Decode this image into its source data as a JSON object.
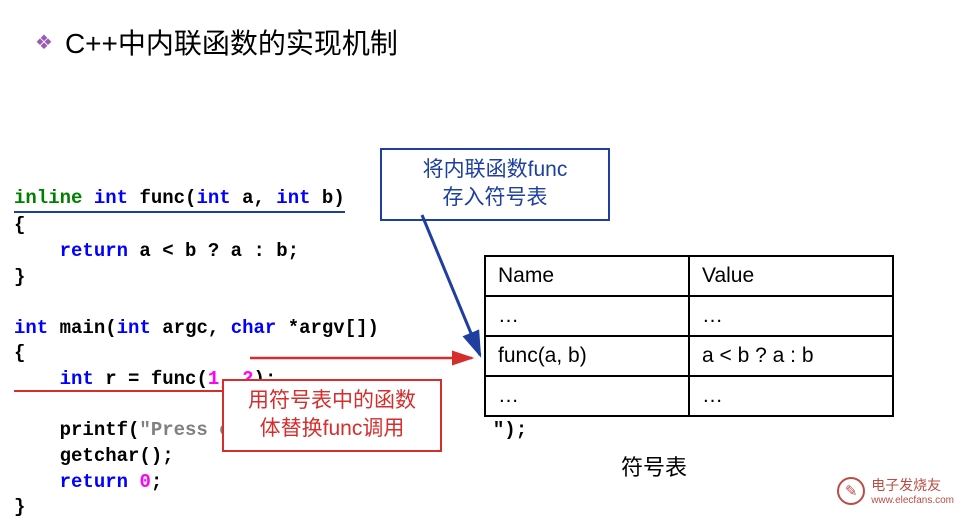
{
  "heading": {
    "bullet": "❖",
    "text": "C++中内联函数的实现机制"
  },
  "code": {
    "sig_inline": "inline",
    "sig_int1": "int",
    "sig_fname": " func(",
    "sig_int2": "int",
    "sig_a": " a, ",
    "sig_int3": "int",
    "sig_b": " b)",
    "brace_open": "{",
    "ret_kw": "    return",
    "ret_expr": " a < b ? a : b;",
    "brace_close": "}",
    "main_int": "int",
    "main_sig1": " main(",
    "main_int2": "int",
    "main_argc": " argc, ",
    "main_char": "char",
    "main_argv": " *argv[])",
    "main_brace_open": "{",
    "r_int": "    int",
    "r_expr": " r = func(",
    "r_1": "1",
    "r_comma": ", ",
    "r_2": "2",
    "r_end": ");",
    "printf1": "    printf(",
    "printf_str": "\"Press en",
    "printf_end": "\");",
    "getchar": "    getchar();",
    "ret0_kw": "    return",
    "ret0_sp": " ",
    "ret0_num": "0",
    "ret0_end": ";",
    "main_brace_close": "}"
  },
  "callout_blue": {
    "line1": "将内联函数func",
    "line2": "存入符号表"
  },
  "callout_red": {
    "line1": "用符号表中的函数",
    "line2": "体替换func调用"
  },
  "table": {
    "h_name": "Name",
    "h_value": "Value",
    "dots": "…",
    "r_name": "func(a, b)",
    "r_value": "a < b ? a : b",
    "caption": "符号表"
  },
  "watermark": {
    "brand1": "电子发烧友",
    "brand2": "www.elecfans.com"
  }
}
